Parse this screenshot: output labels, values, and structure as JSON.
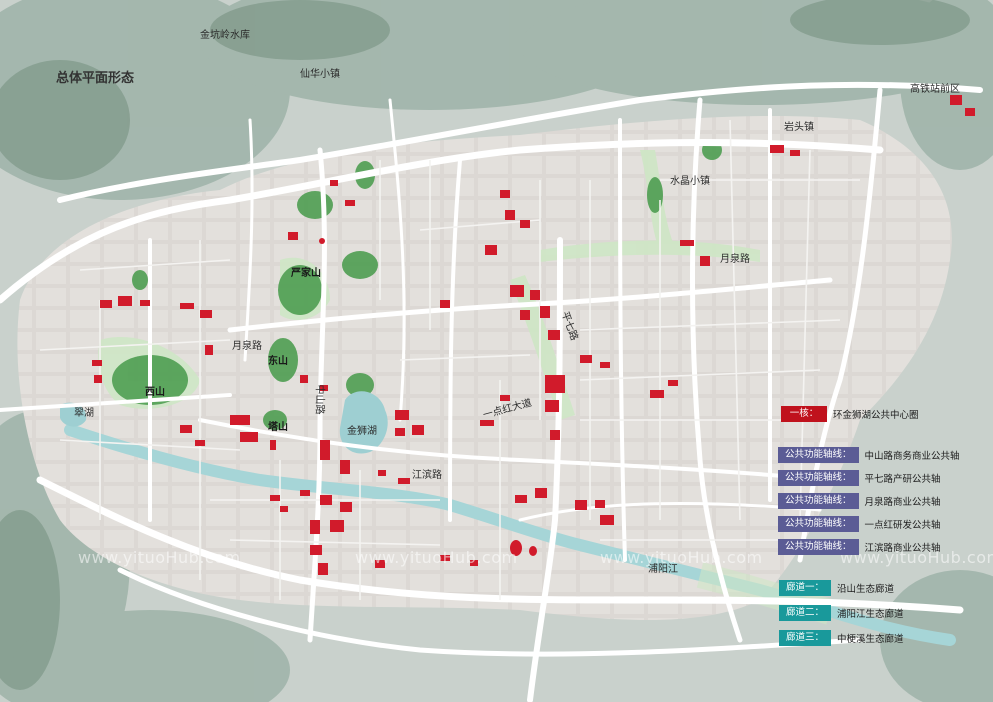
{
  "title": "总体平面形态",
  "place_labels": {
    "jinkengling": "金坑岭水库",
    "xianhua": "仙华小镇",
    "gaotie": "高铁站前区",
    "yantou": "岩头镇",
    "shuijing": "水晶小镇",
    "yanjiashan": "严家山",
    "dongshan": "东山",
    "xishan": "西山",
    "tashan": "塔山",
    "cuihu": "翠湖",
    "jinshihu": "金狮湖",
    "puyangjiang": "浦阳江"
  },
  "road_labels": {
    "yuequan_w": "月泉路",
    "yuequan_e": "月泉路",
    "pingqi": "平七路",
    "yidianhong": "一点红大道",
    "zhongshan": "中山路",
    "jiangbin": "江滨路"
  },
  "watermarks": [
    "www.yituoHub.com",
    "www.yituoHub.com",
    "www.yituoHub.com",
    "www.yituoHub.com"
  ],
  "legend": {
    "core": {
      "tag": "一核：",
      "text": "环金狮湖公共中心圈"
    },
    "axes": [
      {
        "tag": "公共功能轴线：",
        "text": "中山路商务商业公共轴"
      },
      {
        "tag": "公共功能轴线：",
        "text": "平七路产研公共轴"
      },
      {
        "tag": "公共功能轴线：",
        "text": "月泉路商业公共轴"
      },
      {
        "tag": "公共功能轴线：",
        "text": "一点红研发公共轴"
      },
      {
        "tag": "公共功能轴线：",
        "text": "江滨路商业公共轴"
      }
    ],
    "corridors": [
      {
        "tag": "廊道一：",
        "text": "沿山生态廊道"
      },
      {
        "tag": "廊道二：",
        "text": "浦阳江生态廊道"
      },
      {
        "tag": "廊道三：",
        "text": "中梗溪生态廊道"
      }
    ]
  },
  "colors": {
    "mountain": "#8ea59a",
    "land": "#dedbd8",
    "road": "#ffffff",
    "river": "#9ecfd2",
    "greenbelt": "#cfe6c6",
    "forest": "#3f9a4a",
    "public_building": "#d11b2b"
  }
}
